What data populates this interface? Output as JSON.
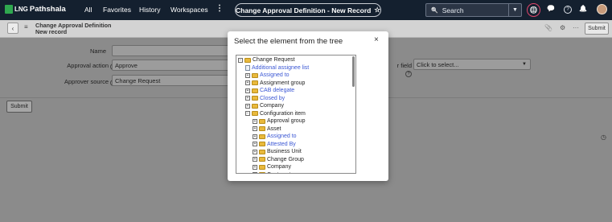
{
  "nav": {
    "logo_prefix": "LNG",
    "logo_text": "Pathshala",
    "links": [
      "All",
      "Favorites",
      "History",
      "Workspaces"
    ],
    "more": "⋮",
    "record_title": "Change Approval Definition - New Record",
    "star": "☆",
    "search_placeholder": "Search",
    "search_icon": "🔍",
    "drop_icon": "▼",
    "globe_icon": "🌐",
    "chat_icon": "💬",
    "help_icon": "?",
    "bell_icon": "🔔"
  },
  "form_header": {
    "back_icon": "‹",
    "menu_icon": "≡",
    "title_line1": "Change Approval Definition",
    "title_line2": "New record",
    "attach_icon": "📎",
    "settings_icon": "⚙",
    "more_icon": "···",
    "submit_label": "Submit"
  },
  "form": {
    "name_label": "Name",
    "name_value": "",
    "approval_action_label": "Approval action",
    "approval_action_value": "Approve",
    "approver_source_label": "Approver source",
    "approver_source_value": "Change Request",
    "field_label": "r field",
    "field_value": "Click to select...",
    "help": "?",
    "arrow": "▼",
    "submit_label": "Submit",
    "clock_icon": "◷"
  },
  "modal": {
    "title": "Select the element from the tree",
    "close": "×",
    "tree": [
      {
        "label": "Change Request",
        "toggle": "−",
        "type": "folder",
        "style": "plain"
      },
      {
        "label": "Additional assignee list",
        "toggle": "",
        "type": "doc",
        "style": "link"
      },
      {
        "label": "Assigned to",
        "toggle": "+",
        "type": "folder",
        "style": "link"
      },
      {
        "label": "Assignment group",
        "toggle": "+",
        "type": "folder",
        "style": "plain"
      },
      {
        "label": "CAB delegate",
        "toggle": "+",
        "type": "folder",
        "style": "link"
      },
      {
        "label": "Closed by",
        "toggle": "+",
        "type": "folder",
        "style": "link"
      },
      {
        "label": "Company",
        "toggle": "+",
        "type": "folder",
        "style": "plain"
      },
      {
        "label": "Configuration item",
        "toggle": "−",
        "type": "folder",
        "style": "plain"
      },
      {
        "label": "Approval group",
        "toggle": "+",
        "type": "folder",
        "style": "plain"
      },
      {
        "label": "Asset",
        "toggle": "+",
        "type": "folder",
        "style": "plain"
      },
      {
        "label": "Assigned to",
        "toggle": "+",
        "type": "folder",
        "style": "link"
      },
      {
        "label": "Attested By",
        "toggle": "+",
        "type": "folder",
        "style": "link"
      },
      {
        "label": "Business Unit",
        "toggle": "+",
        "type": "folder",
        "style": "plain"
      },
      {
        "label": "Change Group",
        "toggle": "+",
        "type": "folder",
        "style": "plain"
      },
      {
        "label": "Company",
        "toggle": "+",
        "type": "folder",
        "style": "plain"
      },
      {
        "label": "Cost center",
        "toggle": "+",
        "type": "folder",
        "style": "plain"
      }
    ]
  }
}
